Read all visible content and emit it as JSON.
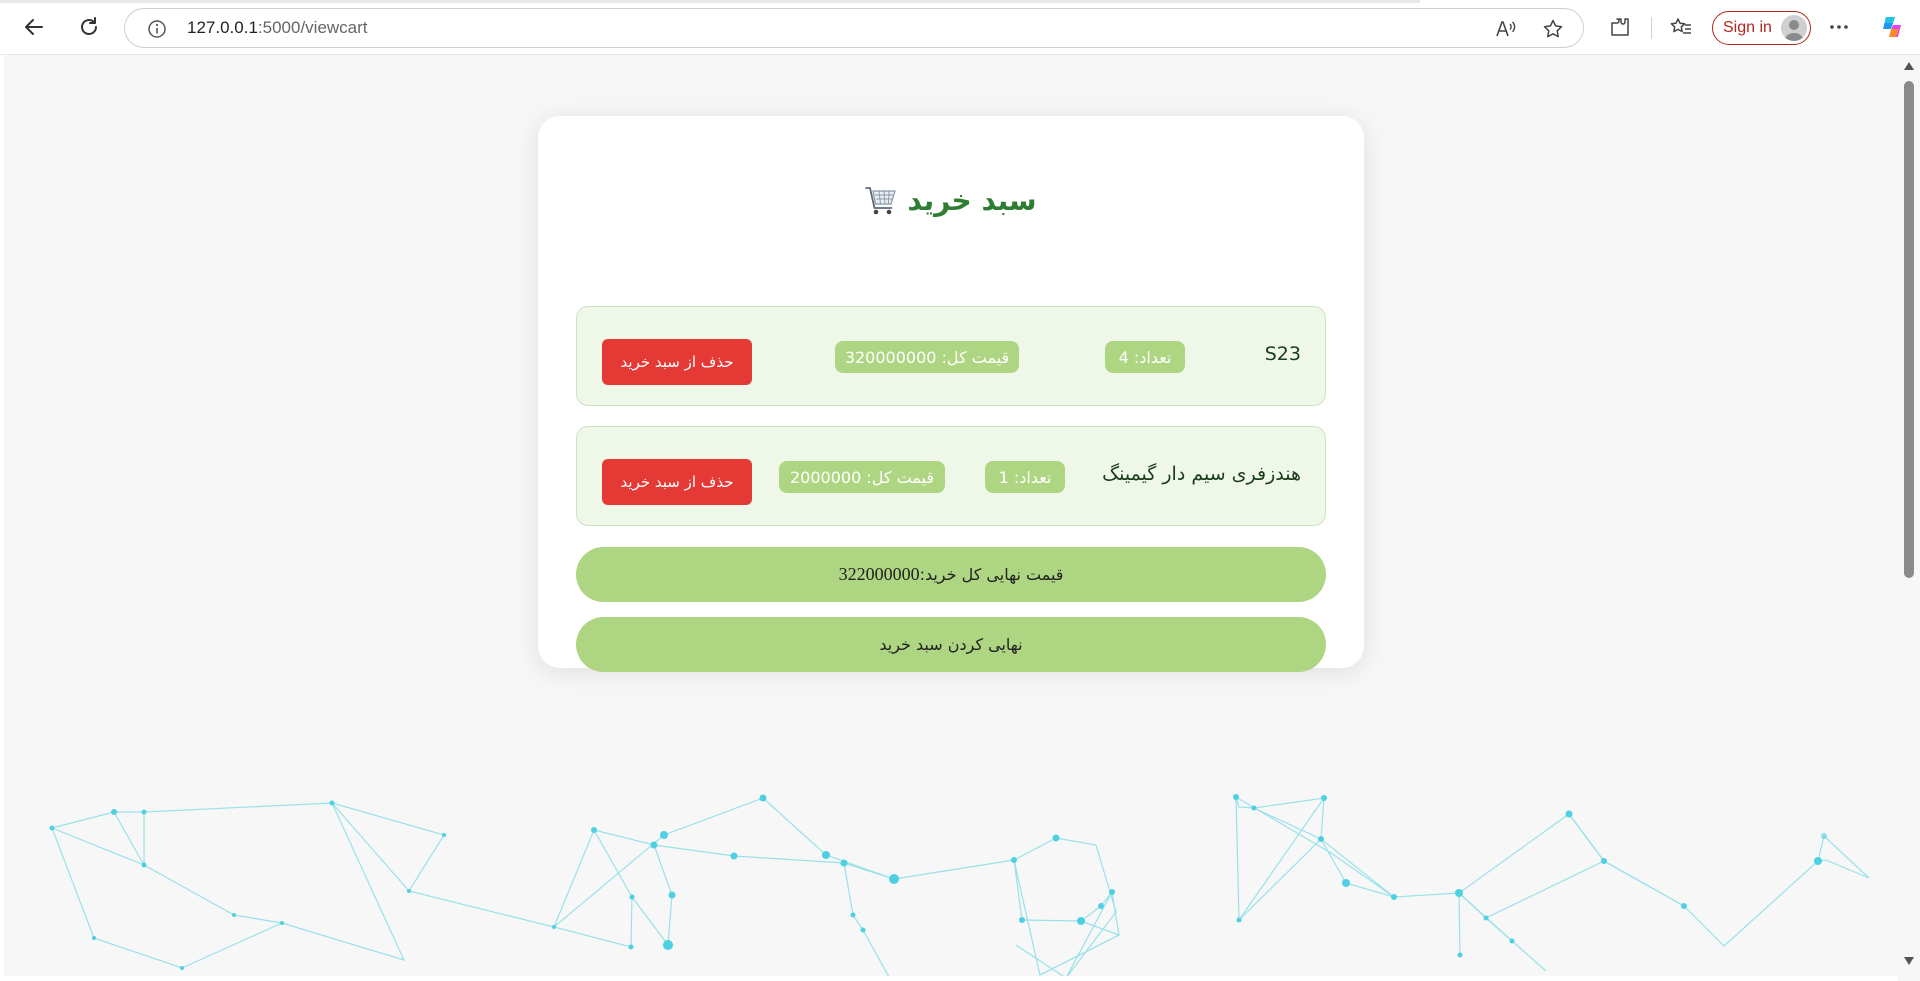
{
  "browser": {
    "url_host": "127.0.0.1",
    "url_path": ":5000/viewcart",
    "signin_label": "Sign in"
  },
  "cart": {
    "title": "سبد خرید",
    "items": [
      {
        "name": "S23",
        "qty_label": "تعداد: 4",
        "total_label": "قیمت کل: 320000000",
        "remove_label": "حذف از سبد خرید"
      },
      {
        "name": "هندزفری سیم دار گیمینگ",
        "qty_label": "تعداد: 1",
        "total_label": "قیمت کل: 2000000",
        "remove_label": "حذف از سبد خرید"
      }
    ],
    "grand_total_label": "قیمت نهایی کل خرید:",
    "grand_total_value": "322000000",
    "finalize_label": "نهایی کردن سبد خرید"
  },
  "colors": {
    "title_green": "#2e7d32",
    "item_bg": "#eef7e8",
    "pill_green": "#aed581",
    "remove_red": "#e53935",
    "network_cyan": "#4dd0e1"
  }
}
